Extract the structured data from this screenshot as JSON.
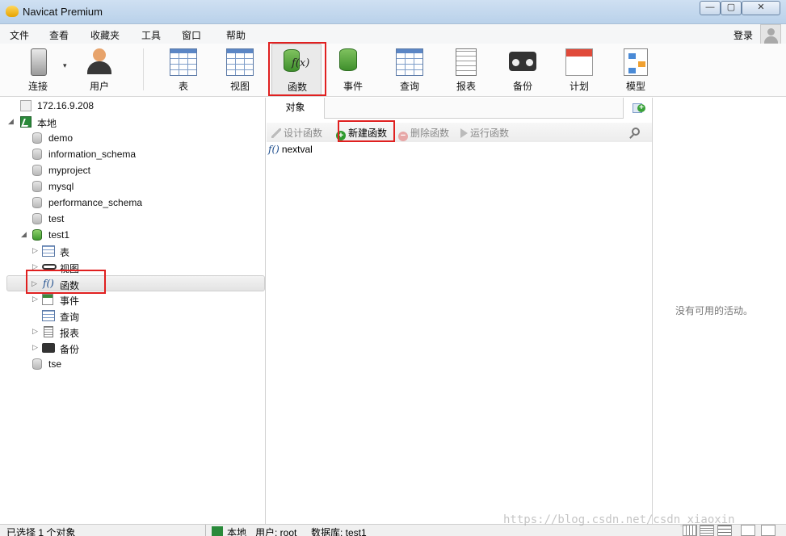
{
  "window": {
    "title": "Navicat Premium",
    "min": "—",
    "max": "▢",
    "close": "✕"
  },
  "menu": {
    "items": [
      "文件",
      "查看",
      "收藏夹",
      "工具",
      "窗口",
      "帮助"
    ],
    "login": "登录"
  },
  "toolbar": {
    "buttons": [
      {
        "label": "连接",
        "icon": "connection-icon"
      },
      {
        "label": "用户",
        "icon": "user-icon"
      },
      {
        "label": "表",
        "icon": "table-icon"
      },
      {
        "label": "视图",
        "icon": "view-icon"
      },
      {
        "label": "函数",
        "icon": "function-icon",
        "highlighted": true
      },
      {
        "label": "事件",
        "icon": "event-icon"
      },
      {
        "label": "查询",
        "icon": "query-icon"
      },
      {
        "label": "报表",
        "icon": "report-icon"
      },
      {
        "label": "备份",
        "icon": "backup-icon"
      },
      {
        "label": "计划",
        "icon": "schedule-icon"
      },
      {
        "label": "模型",
        "icon": "model-icon"
      }
    ],
    "connect_dropdown": "▾",
    "function_glyph": "f(x)"
  },
  "tree": {
    "server": "172.16.9.208",
    "local": "本地",
    "databases": [
      "demo",
      "information_schema",
      "myproject",
      "mysql",
      "performance_schema",
      "test",
      "test1"
    ],
    "test1_children": [
      "表",
      "视图",
      "函数",
      "事件",
      "查询",
      "报表",
      "备份"
    ],
    "last_db": "tse",
    "fx_glyph": "f()",
    "expand_open": "◢",
    "expand_closed": "▷"
  },
  "center": {
    "tab": "对象",
    "actions": {
      "design": "设计函数",
      "new": "新建函数",
      "delete": "删除函数",
      "run": "运行函数"
    },
    "functions": [
      {
        "glyph": "f()",
        "name": "nextval"
      }
    ]
  },
  "right": {
    "empty_text": "没有可用的活动。"
  },
  "status": {
    "selection": "已选择 1 个对象",
    "connection": "本地",
    "user": "用户: root",
    "database": "数据库: test1"
  },
  "watermark": "https://blog.csdn.net/csdn_xiaoxin",
  "colors": {
    "highlight_border": "#e02020",
    "accent_green": "#3aa23a",
    "titlebar": "#c3d7ee"
  }
}
